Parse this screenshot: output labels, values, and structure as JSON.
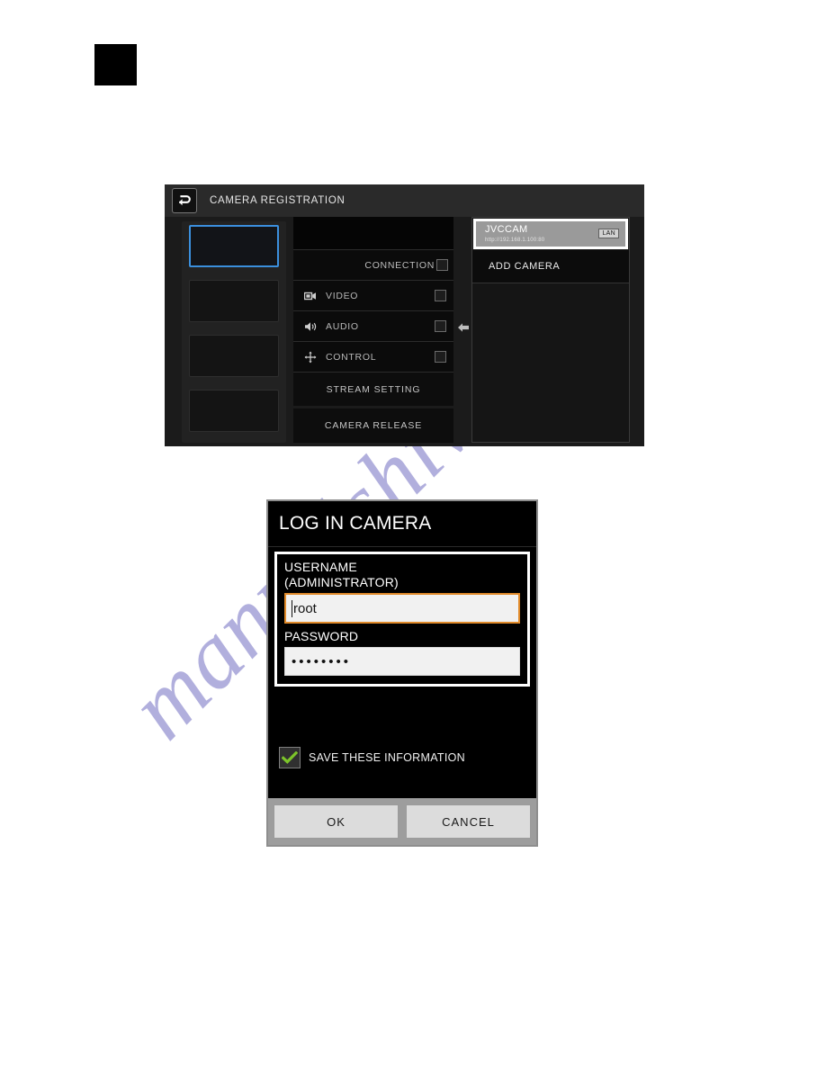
{
  "watermark": {
    "text": "manualshive.com"
  },
  "registration": {
    "title": "CAMERA REGISTRATION",
    "back_icon": "back-arrow-icon",
    "thumbnails": [
      {
        "label": "",
        "selected": true
      },
      {
        "label": "",
        "selected": false
      },
      {
        "label": "",
        "selected": false
      },
      {
        "label": "",
        "selected": false
      }
    ],
    "settings": {
      "rows": [
        {
          "label": "CONNECTION",
          "icon": "",
          "checkbox": true
        },
        {
          "label": "VIDEO",
          "icon": "video-icon",
          "checkbox": true
        },
        {
          "label": "AUDIO",
          "icon": "audio-icon",
          "checkbox": true
        },
        {
          "label": "CONTROL",
          "icon": "control-icon",
          "checkbox": true
        }
      ],
      "stream_setting": "STREAM SETTING",
      "camera_release": "CAMERA RELEASE"
    },
    "arrow_icon": "left-arrow-icon",
    "camera_list": {
      "selected_camera": {
        "name": "JVCCAM",
        "url": "http://192.168.1.100:80",
        "badge": "LAN"
      },
      "add_camera": "ADD CAMERA"
    }
  },
  "login": {
    "title": "LOG IN CAMERA",
    "username_label": "USERNAME\n(ADMINISTRATOR)",
    "username_label_line1": "USERNAME",
    "username_label_line2": "(ADMINISTRATOR)",
    "username_value": "root",
    "password_label": "PASSWORD",
    "password_value": "••••••••",
    "save_info_label": "SAVE THESE INFORMATION",
    "save_info_checked": true,
    "ok_label": "OK",
    "cancel_label": "CANCEL"
  },
  "colors": {
    "selection_blue": "#3b8fdd",
    "focus_orange": "#e08a2a",
    "check_green": "#7cc42a",
    "watermark": "#3c37aa"
  }
}
